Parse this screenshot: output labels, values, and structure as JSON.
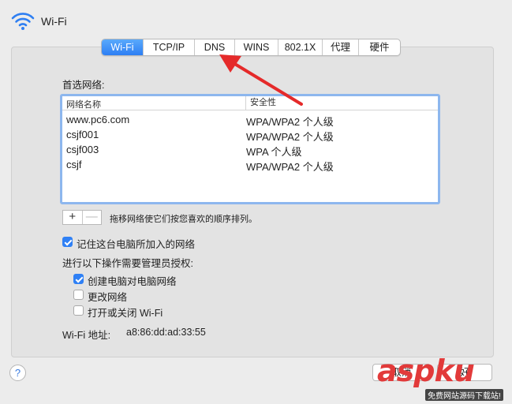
{
  "header": {
    "title": "Wi-Fi"
  },
  "tabs": [
    {
      "label": "Wi-Fi",
      "active": true
    },
    {
      "label": "TCP/IP"
    },
    {
      "label": "DNS"
    },
    {
      "label": "WINS"
    },
    {
      "label": "802.1X"
    },
    {
      "label": "代理"
    },
    {
      "label": "硬件"
    }
  ],
  "preferred": {
    "label": "首选网络:",
    "columns": [
      "网络名称",
      "安全性"
    ],
    "rows": [
      {
        "name": "www.pc6.com",
        "security": "WPA/WPA2 个人级"
      },
      {
        "name": "csjf001",
        "security": "WPA/WPA2 个人级"
      },
      {
        "name": "csjf003",
        "security": "WPA 个人级"
      },
      {
        "name": "csjf",
        "security": "WPA/WPA2 个人级"
      }
    ],
    "add_label": "+",
    "remove_label": "—",
    "hint": "拖移网络使它们按您喜欢的顺序排列。"
  },
  "options": {
    "remember": {
      "label": "记住这台电脑所加入的网络",
      "checked": true
    },
    "admin_label": "进行以下操作需要管理员授权:",
    "admin_items": [
      {
        "label": "创建电脑对电脑网络",
        "checked": true
      },
      {
        "label": "更改网络",
        "checked": false
      },
      {
        "label": "打开或关闭 Wi-Fi",
        "checked": false
      }
    ]
  },
  "address": {
    "label": "Wi-Fi 地址:",
    "value": "a8:86:dd:ad:33:55"
  },
  "footer": {
    "help": "?",
    "cancel": "取消",
    "ok": "好"
  },
  "watermark": {
    "brand": "aspku",
    "sub": "免费网站源码下载站!"
  },
  "colors": {
    "accent": "#2f80f5",
    "arrow": "#e52a2a"
  }
}
